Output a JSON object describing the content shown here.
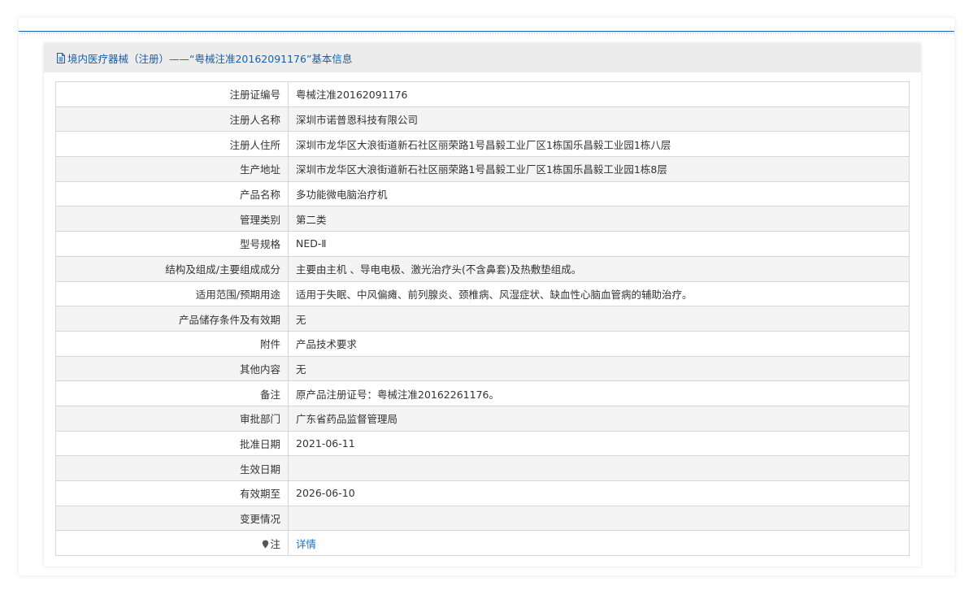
{
  "panel": {
    "title": "境内医疗器械（注册）——“粤械注准20162091176”基本信息"
  },
  "rows": [
    {
      "label": "注册证编号",
      "value": "粤械注准20162091176"
    },
    {
      "label": "注册人名称",
      "value": "深圳市诺普恩科技有限公司"
    },
    {
      "label": "注册人住所",
      "value": "深圳市龙华区大浪街道新石社区丽荣路1号昌毅工业厂区1栋国乐昌毅工业园1栋八层"
    },
    {
      "label": "生产地址",
      "value": "深圳市龙华区大浪街道新石社区丽荣路1号昌毅工业厂区1栋国乐昌毅工业园1栋8层"
    },
    {
      "label": "产品名称",
      "value": "多功能微电脑治疗机"
    },
    {
      "label": "管理类别",
      "value": "第二类"
    },
    {
      "label": "型号规格",
      "value": "NED-Ⅱ"
    },
    {
      "label": "结构及组成/主要组成成分",
      "value": "主要由主机 、导电电极、激光治疗头(不含鼻套)及热敷垫组成。"
    },
    {
      "label": "适用范围/预期用途",
      "value": "适用于失眠、中风偏瘫、前列腺炎、颈椎病、风湿症状、缺血性心脑血管病的辅助治疗。"
    },
    {
      "label": "产品储存条件及有效期",
      "value": "无"
    },
    {
      "label": "附件",
      "value": "产品技术要求"
    },
    {
      "label": "其他内容",
      "value": "无"
    },
    {
      "label": "备注",
      "value": "原产品注册证号：粤械注准20162261176。"
    },
    {
      "label": "审批部门",
      "value": "广东省药品监督管理局"
    },
    {
      "label": "批准日期",
      "value": "2021-06-11"
    },
    {
      "label": "生效日期",
      "value": ""
    },
    {
      "label": "有效期至",
      "value": "2026-06-10"
    },
    {
      "label": "变更情况",
      "value": ""
    },
    {
      "label": "注",
      "value": "详情"
    }
  ],
  "icons": {
    "title_icon": "document-icon",
    "note_icon": "pin-icon"
  },
  "colors": {
    "accent": "#1a5ea8",
    "link": "#1a6fc4"
  }
}
